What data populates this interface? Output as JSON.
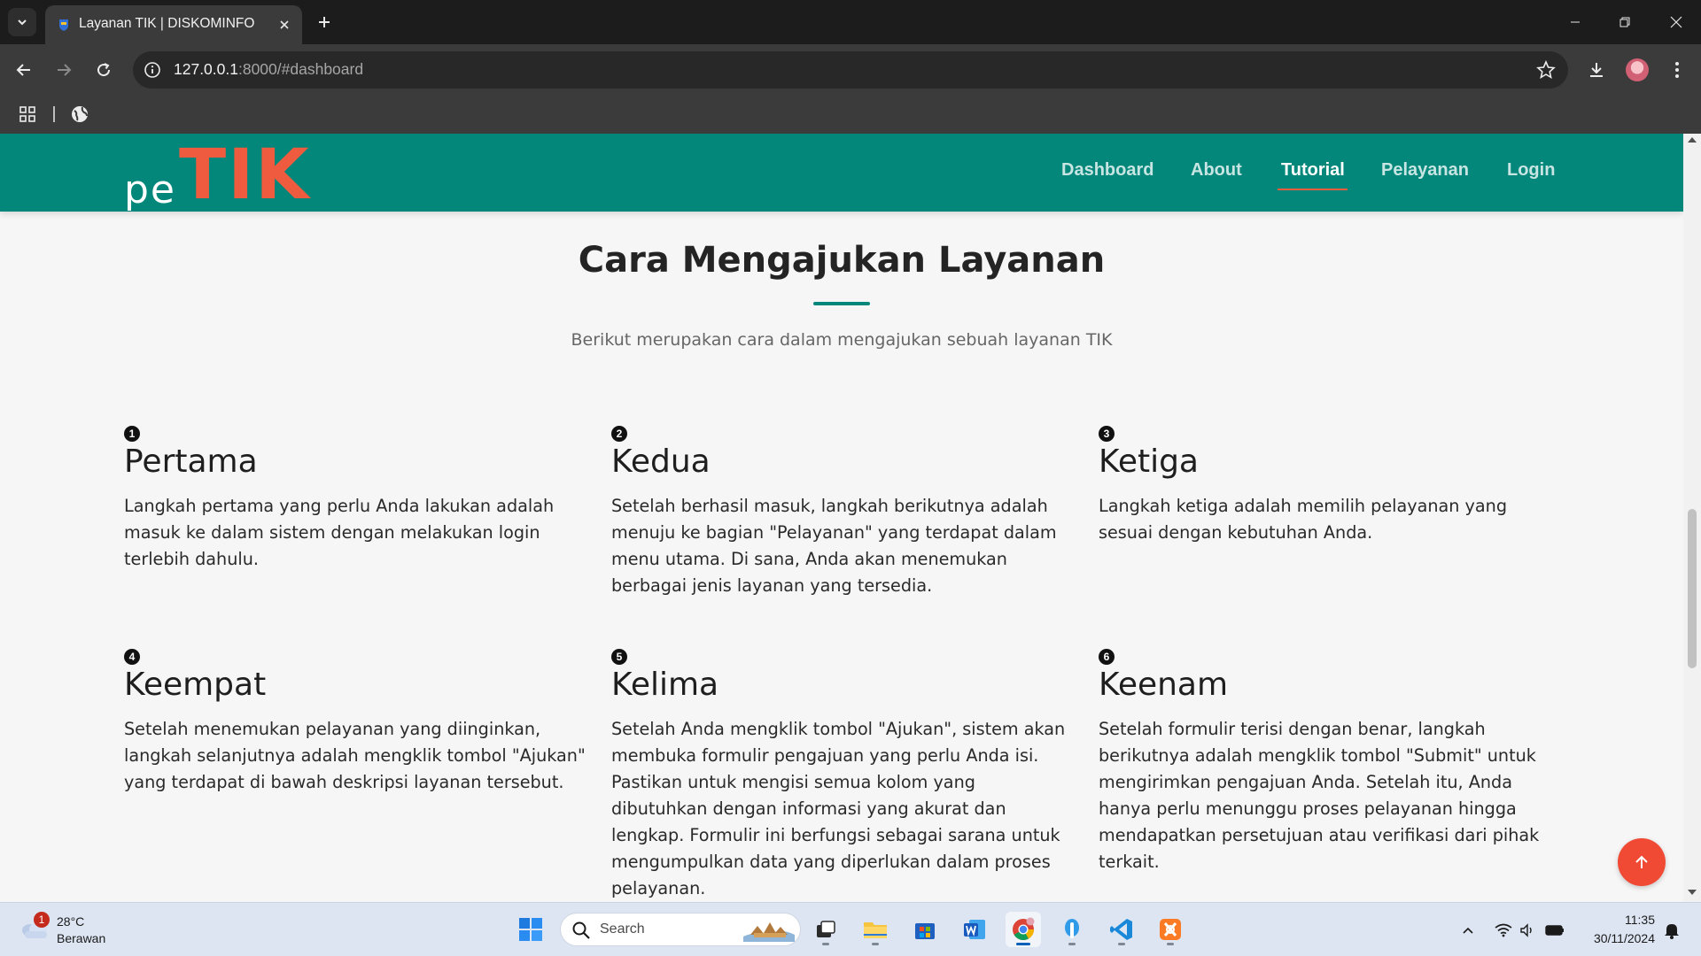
{
  "browser": {
    "tab_title": "Layanan TIK | DISKOMINFO",
    "url_host": "127.0.0.1",
    "url_rest": ":8000/#dashboard"
  },
  "site": {
    "logo_pe": "pe",
    "logo_tik": "TIK",
    "nav": [
      {
        "label": "Dashboard"
      },
      {
        "label": "About"
      },
      {
        "label": "Tutorial"
      },
      {
        "label": "Pelayanan"
      },
      {
        "label": "Login"
      }
    ],
    "active_nav": "Tutorial",
    "colors": {
      "header": "#03877a",
      "accent": "#ef5b3f",
      "scroll_top": "#f04a35"
    }
  },
  "section": {
    "title": "Cara Mengajukan Layanan",
    "subtitle": "Berikut merupakan cara dalam mengajukan sebuah layanan TIK"
  },
  "steps": [
    {
      "num": "1",
      "title": "Pertama",
      "text": "Langkah pertama yang perlu Anda lakukan adalah masuk ke dalam sistem dengan melakukan login terlebih dahulu."
    },
    {
      "num": "2",
      "title": "Kedua",
      "text": "Setelah berhasil masuk, langkah berikutnya adalah menuju ke bagian \"Pelayanan\" yang terdapat dalam menu utama. Di sana, Anda akan menemukan berbagai jenis layanan yang tersedia."
    },
    {
      "num": "3",
      "title": "Ketiga",
      "text": "Langkah ketiga adalah memilih pelayanan yang sesuai dengan kebutuhan Anda."
    },
    {
      "num": "4",
      "title": "Keempat",
      "text": "Setelah menemukan pelayanan yang diinginkan, langkah selanjutnya adalah mengklik tombol \"Ajukan\" yang terdapat di bawah deskripsi layanan tersebut."
    },
    {
      "num": "5",
      "title": "Kelima",
      "text": "Setelah Anda mengklik tombol \"Ajukan\", sistem akan membuka formulir pengajuan yang perlu Anda isi. Pastikan untuk mengisi semua kolom yang dibutuhkan dengan informasi yang akurat dan lengkap. Formulir ini berfungsi sebagai sarana untuk mengumpulkan data yang diperlukan dalam proses pelayanan."
    },
    {
      "num": "6",
      "title": "Keenam",
      "text": "Setelah formulir terisi dengan benar, langkah berikutnya adalah mengklik tombol \"Submit\" untuk mengirimkan pengajuan Anda. Setelah itu, Anda hanya perlu menunggu proses pelayanan hingga mendapatkan persetujuan atau verifikasi dari pihak terkait."
    }
  ],
  "taskbar": {
    "weather_temp": "28°C",
    "weather_cond": "Berawan",
    "weather_badge": "1",
    "search_label": "Search",
    "time": "11:35",
    "date": "30/11/2024",
    "apps": [
      "task-view",
      "file-explorer",
      "microsoft-store",
      "word",
      "chrome",
      "app-blue",
      "vscode",
      "xampp"
    ],
    "active_app": "chrome"
  }
}
